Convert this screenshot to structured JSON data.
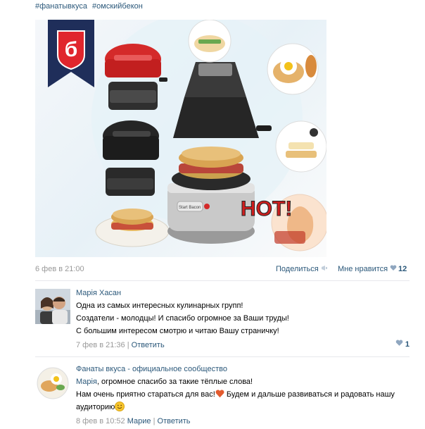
{
  "hashtags": [
    "#фанатывкуса",
    "#омскийбекон"
  ],
  "post": {
    "image_banner_letter": "б",
    "image_caption": "HOT!",
    "device_button_label": "Start Bacon",
    "date": "6 фев в 21:00",
    "share_label": "Поделиться",
    "like_label": "Мне нравится",
    "like_count": "12"
  },
  "comments": [
    {
      "author": "Марія Хасан",
      "lines": [
        "Одна из самых интересных кулинарных групп!",
        "Создатели - молодцы! И спасибо огромное за Ваши труды!",
        "С большим интересом смотрю и читаю Вашу страничку!"
      ],
      "date": "7 фев в 21:36",
      "separator": "|",
      "reply_label": "Ответить",
      "like_count": "1"
    },
    {
      "author": "Фанаты вкуса - официальное сообщество",
      "reply_to_name": "Марія",
      "lines": [
        ", огромное спасибо за такие тёплые слова!",
        "Нам очень приятно стараться для вас!",
        " Будем и дальше развиваться и радовать нашу",
        "аудиторию"
      ],
      "date": "8 фев в 10:52",
      "reply_target": "Марие",
      "separator": "|",
      "reply_label": "Ответить"
    }
  ],
  "colors": {
    "link": "#2b587a",
    "muted": "#999999",
    "brand_red": "#e0262d",
    "brand_navy": "#1f2e5a"
  }
}
